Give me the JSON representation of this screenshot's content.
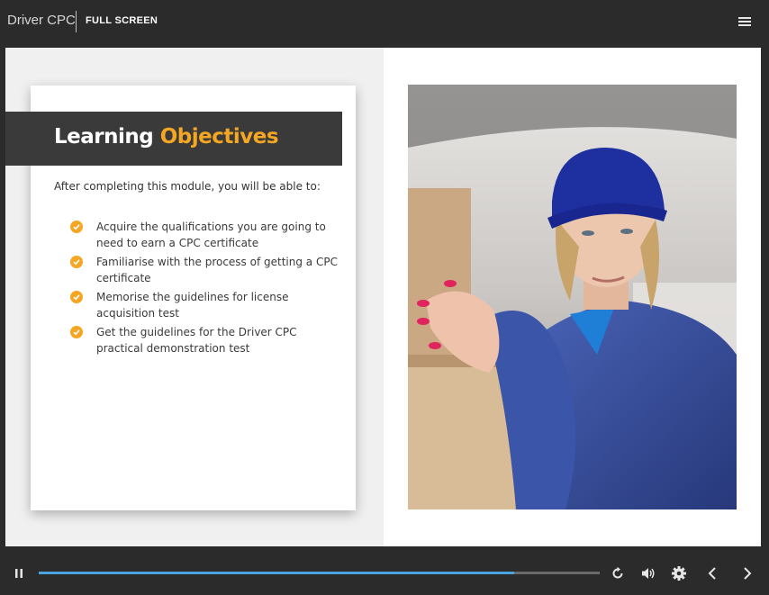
{
  "header": {
    "app_title": "Driver CPC",
    "fullscreen_label": "FULL SCREEN",
    "menu_icon": "hamburger-menu-icon"
  },
  "slide": {
    "title_part1": "Learning",
    "title_part2": "Objectives",
    "intro": "After completing this module, you will be able to:",
    "objectives": [
      {
        "line1": "Acquire the qualifications you are going to",
        "line2": "need to earn a CPC certificate"
      },
      {
        "line1": "Familiarise with the process of getting a CPC",
        "line2": "certificate"
      },
      {
        "line1": "Memorise the guidelines for license",
        "line2": "acquisition test"
      },
      {
        "line1": "Get the guidelines for the Driver CPC",
        "line2": "practical demonstration test"
      }
    ],
    "image_subject": "delivery-woman-in-blue-cap-with-boxes-in-van",
    "accent_color": "#f5a623"
  },
  "controls": {
    "play_state": "playing",
    "progress_fraction": 0.847,
    "icons": [
      "pause-icon",
      "replay-icon",
      "volume-icon",
      "settings-icon",
      "previous-icon",
      "next-icon"
    ],
    "progress_color": "#4aa3df"
  }
}
